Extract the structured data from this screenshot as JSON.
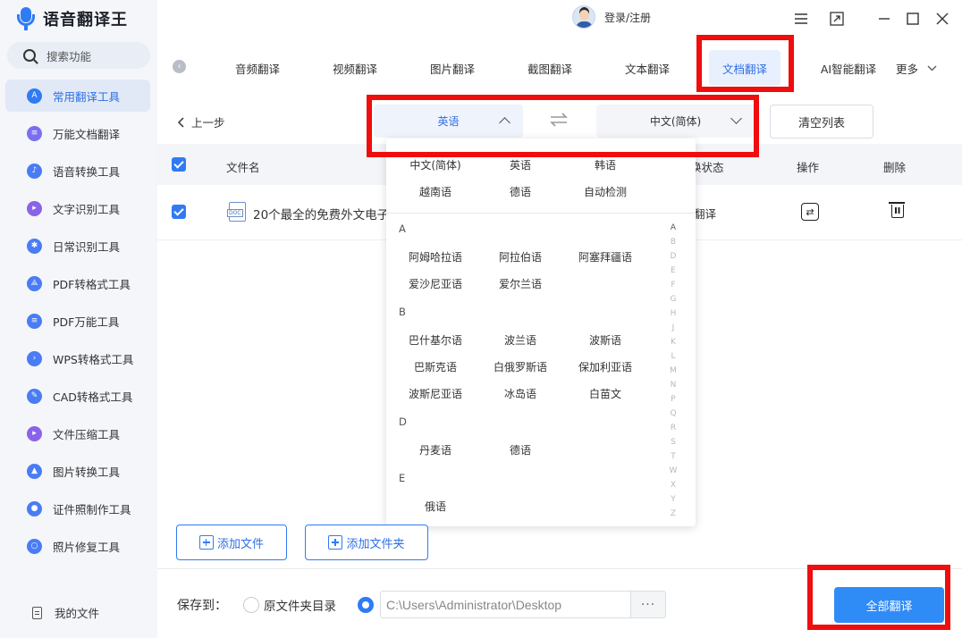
{
  "app": {
    "title": "语音翻译王",
    "brand_color": "#2f7bf5"
  },
  "header": {
    "login_label": "登录/注册"
  },
  "sidebar": {
    "search_label": "搜索功能",
    "items": [
      {
        "label": "常用翻译工具",
        "icon": "translate-icon",
        "color": "#2f7bf5",
        "active": true
      },
      {
        "label": "万能文档翻译",
        "icon": "document-icon",
        "color": "#7a6ff0"
      },
      {
        "label": "语音转换工具",
        "icon": "music-note-icon",
        "color": "#4a7cf5"
      },
      {
        "label": "文字识别工具",
        "icon": "text-scan-icon",
        "color": "#8a63e8"
      },
      {
        "label": "日常识别工具",
        "icon": "recognize-icon",
        "color": "#4a7cf5"
      },
      {
        "label": "PDF转格式工具",
        "icon": "pdf-icon",
        "color": "#4a7cf5"
      },
      {
        "label": "PDF万能工具",
        "icon": "pdf-tools-icon",
        "color": "#4a7cf5"
      },
      {
        "label": "WPS转格式工具",
        "icon": "wps-icon",
        "color": "#4a7cf5"
      },
      {
        "label": "CAD转格式工具",
        "icon": "cad-icon",
        "color": "#4a7cf5"
      },
      {
        "label": "文件压缩工具",
        "icon": "compress-icon",
        "color": "#8a63e8"
      },
      {
        "label": "图片转换工具",
        "icon": "image-icon",
        "color": "#4a7cf5"
      },
      {
        "label": "证件照制作工具",
        "icon": "id-photo-icon",
        "color": "#4a7cf5"
      },
      {
        "label": "照片修复工具",
        "icon": "photo-repair-icon",
        "color": "#4a7cf5"
      }
    ],
    "my_files_label": "我的文件"
  },
  "tabs": [
    {
      "label": "音频翻译"
    },
    {
      "label": "视频翻译"
    },
    {
      "label": "图片翻译"
    },
    {
      "label": "截图翻译"
    },
    {
      "label": "文本翻译"
    },
    {
      "label": "文档翻译",
      "active": true
    },
    {
      "label": "AI智能翻译"
    },
    {
      "label": "更多"
    }
  ],
  "toolbar": {
    "prev_step_label": "上一步",
    "source_lang": "英语",
    "target_lang": "中文(简体)",
    "clear_list_label": "清空列表"
  },
  "table": {
    "headers": {
      "file_name": "文件名",
      "status": "换状态",
      "actions": "操作",
      "delete": "删除"
    },
    "rows": [
      {
        "file_name": "20个最全的免费外文电子",
        "status": "翻译",
        "file_type": "DOC"
      }
    ]
  },
  "dropdown": {
    "common": [
      [
        "中文(简体)",
        "英语",
        "韩语"
      ],
      [
        "越南语",
        "德语",
        "自动检测"
      ]
    ],
    "groups": [
      {
        "letter": "A",
        "rows": [
          [
            "阿姆哈拉语",
            "阿拉伯语",
            "阿塞拜疆语"
          ],
          [
            "爱沙尼亚语",
            "爱尔兰语"
          ]
        ]
      },
      {
        "letter": "B",
        "rows": [
          [
            "巴什基尔语",
            "波兰语",
            "波斯语"
          ],
          [
            "巴斯克语",
            "白俄罗斯语",
            "保加利亚语"
          ],
          [
            "波斯尼亚语",
            "冰岛语",
            "白苗文"
          ]
        ]
      },
      {
        "letter": "D",
        "rows": [
          [
            "丹麦语",
            "德语"
          ]
        ]
      },
      {
        "letter": "E",
        "rows": [
          [
            "俄语"
          ]
        ]
      }
    ],
    "index": [
      "A",
      "B",
      "D",
      "E",
      "F",
      "G",
      "H",
      "J",
      "K",
      "L",
      "M",
      "N",
      "P",
      "Q",
      "R",
      "S",
      "T",
      "W",
      "X",
      "Y",
      "Z"
    ]
  },
  "bottom": {
    "add_file_label": "添加文件",
    "add_folder_label": "添加文件夹",
    "save_to_label": "保存到：",
    "original_dir_label": "原文件夹目录",
    "path_value": "C:\\Users\\Administrator\\Desktop",
    "more_label": "···",
    "translate_all_label": "全部翻译"
  },
  "highlight_color": "#f00d0d"
}
